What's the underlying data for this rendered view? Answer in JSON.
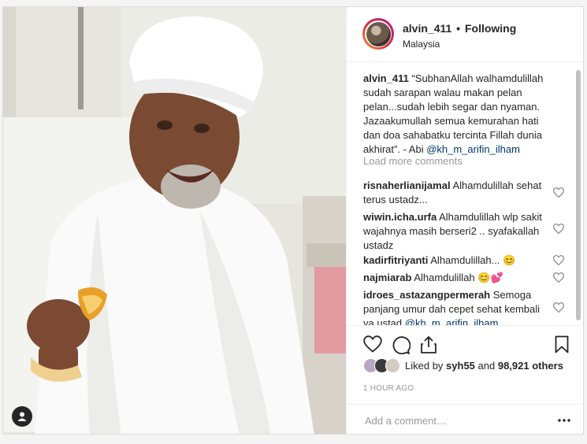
{
  "post": {
    "username": "alvin_411",
    "follow_status": "Following",
    "separator": "•",
    "location": "Malaysia"
  },
  "caption": {
    "username": "alvin_411",
    "text": "“SubhanAllah walhamdulillah sudah sarapan walau makan pelan pelan...sudah lebih segar dan nyaman. Jazaakumullah semua kemurahan hati dan doa sahabatku tercinta Fillah dunia akhirat”. - Abi ",
    "mention": "@kh_m_arifin_ilham"
  },
  "load_more": "Load more comments",
  "comments": [
    {
      "username": "risnaherlianijamal",
      "text": "Alhamdulillah sehat terus ustadz..."
    },
    {
      "username": "wiwin.icha.urfa",
      "text": "Alhamdulillah wlp sakit wajahnya masih berseri2 .. syafakallah ustadz"
    },
    {
      "username": "kadirfitriyanti",
      "text": "Alhamdulillah... 😊"
    },
    {
      "username": "najmiarab",
      "text": "Alhamdulillah 😊💕"
    },
    {
      "username": "idroes_astazangpermerah",
      "text": "Semoga panjang umur dah cepet sehat kembali ya ustad ",
      "mention": "@kh_m_arifin_ilham"
    }
  ],
  "likes": {
    "prefix": "Liked by ",
    "first_user": "syh55",
    "joiner": " and ",
    "others": "98,921 others"
  },
  "timestamp": "1 HOUR AGO",
  "add_comment_placeholder": "Add a comment…",
  "icons": {
    "like": "heart-icon",
    "comment": "comment-icon",
    "share": "share-icon",
    "save": "bookmark-icon",
    "more": "more-options-icon",
    "user_tag": "user-tag-icon"
  },
  "colors": {
    "link": "#003569",
    "muted": "#999999",
    "text": "#262626",
    "border": "#efefef"
  }
}
